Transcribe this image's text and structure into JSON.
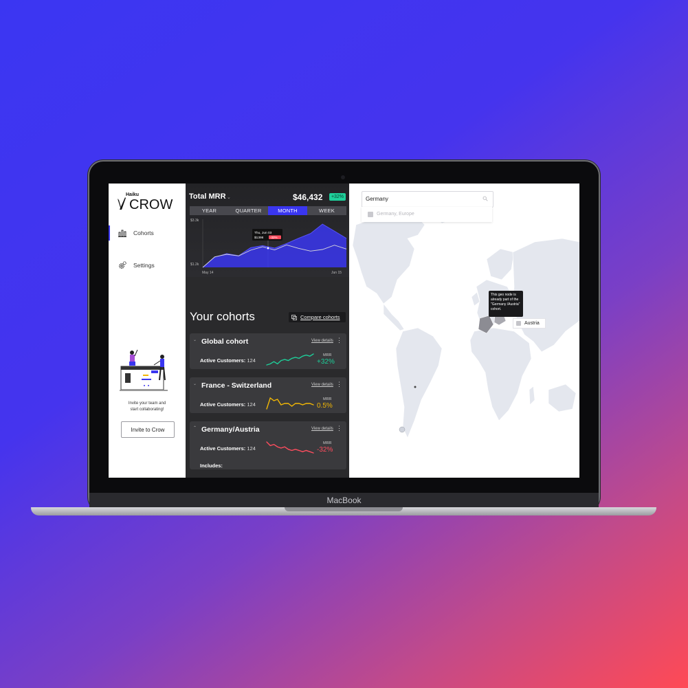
{
  "device": {
    "brand_label": "MacBook"
  },
  "sidebar": {
    "logo_small": "Haiku",
    "logo_big": "CROW",
    "items": [
      {
        "label": "Cohorts",
        "icon": "bar-chart-icon",
        "active": true
      },
      {
        "label": "Settings",
        "icon": "gears-icon",
        "active": false
      }
    ],
    "invite_text_line1": "Invite your team and",
    "invite_text_line2": "start collaborating!",
    "invite_button": "Invite to Crow"
  },
  "mrr": {
    "title": "Total MRR",
    "value": "$46,432",
    "change": "+32%",
    "tabs": [
      "YEAR",
      "QUARTER",
      "MONTH",
      "WEEK"
    ],
    "active_tab": "MONTH"
  },
  "chart_data": {
    "type": "area",
    "title": "Total MRR",
    "x_labels": [
      "May 14",
      "Jun 15"
    ],
    "y_labels": [
      "$3.3k",
      "$1.2k"
    ],
    "ylim": [
      1200,
      3300
    ],
    "series": [
      {
        "color": "#3a36f0",
        "values": [
          1200,
          1640,
          1800,
          1710,
          2060,
          2150,
          2040,
          2240,
          2470,
          2680,
          3090,
          2780,
          2470
        ]
      },
      {
        "color": "#d8d8dc",
        "values": [
          1200,
          1660,
          1770,
          1700,
          1950,
          2100,
          1960,
          2180,
          2030,
          1910,
          1980,
          2170,
          2000
        ]
      }
    ],
    "tooltip": {
      "date": "Thu, Jun 03",
      "value": "$1398",
      "badge": "-32%"
    },
    "grid": false
  },
  "cohorts": {
    "title": "Your cohorts",
    "compare_label": "Compare cohorts",
    "view_details": "View details",
    "active_label": "Active Customers:",
    "mrr_label": "MRR",
    "includes_label": "Includes:",
    "items": [
      {
        "name": "Global cohort",
        "customers": "124",
        "mrr": "+32%",
        "color": "#1ecf9a",
        "spark": [
          5,
          6,
          8,
          6,
          9,
          10,
          9,
          11,
          12,
          11,
          13,
          14,
          13,
          15
        ]
      },
      {
        "name": "France - Switzerland",
        "customers": "124",
        "mrr": "0.5%",
        "color": "#f2b705",
        "spark": [
          6,
          14,
          12,
          13,
          9,
          10,
          10,
          8,
          10,
          10,
          9,
          10,
          10,
          9
        ]
      },
      {
        "name": "Germany/Austria",
        "customers": "124",
        "mrr": "-32%",
        "color": "#ff4d5e",
        "spark": [
          14,
          11,
          12,
          10,
          9,
          10,
          8,
          7,
          8,
          7,
          6,
          7,
          6,
          5
        ]
      }
    ]
  },
  "map": {
    "search_value": "Germany",
    "suggestion": "Germany, Europe",
    "tooltip_text": "This geo node is already part of the \"Germany /Austria\" cohort.",
    "austria_label": "Austria"
  },
  "colors": {
    "accent": "#3a36f0",
    "panel": "#2a2a2c",
    "positive": "#1ecf9a",
    "negative": "#ff4d5e",
    "neutral": "#f2b705"
  }
}
